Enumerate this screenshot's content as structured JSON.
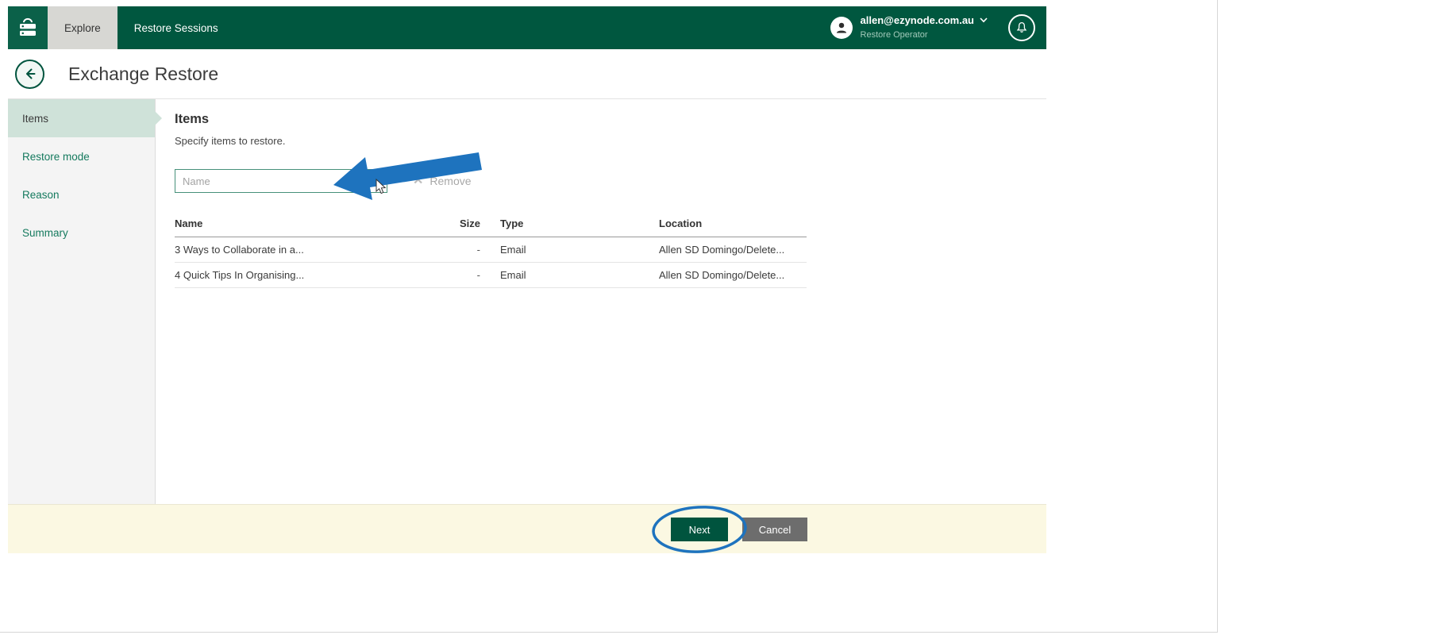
{
  "topbar": {
    "tabs": [
      {
        "label": "Explore",
        "active": true
      },
      {
        "label": "Restore Sessions",
        "active": false
      }
    ],
    "user": {
      "email": "allen@ezynode.com.au",
      "role": "Restore Operator"
    }
  },
  "header": {
    "title": "Exchange Restore"
  },
  "sidebar": {
    "steps": [
      {
        "label": "Items",
        "active": true
      },
      {
        "label": "Restore mode",
        "active": false
      },
      {
        "label": "Reason",
        "active": false
      },
      {
        "label": "Summary",
        "active": false
      }
    ]
  },
  "content": {
    "heading": "Items",
    "description": "Specify items to restore.",
    "filter": {
      "placeholder": "Name"
    },
    "remove_button": "Remove",
    "table": {
      "columns": {
        "name": "Name",
        "size": "Size",
        "type": "Type",
        "location": "Location"
      },
      "rows": [
        {
          "name": "3 Ways to Collaborate in a...",
          "size": "-",
          "type": "Email",
          "location": "Allen SD Domingo/Delete..."
        },
        {
          "name": "4 Quick Tips In Organising...",
          "size": "-",
          "type": "Email",
          "location": "Allen SD Domingo/Delete..."
        }
      ]
    }
  },
  "footer": {
    "next": "Next",
    "cancel": "Cancel"
  },
  "icons": {
    "logo": "server-stack",
    "avatar": "person",
    "chevron": "chevron-down",
    "bell": "bell",
    "back": "arrow-left",
    "remove_glyph": "✕"
  },
  "colors": {
    "brand_green": "#00573f",
    "button_green": "#00543e",
    "sidebar_active": "#cfe2d9",
    "footer_yellow": "#fbf8e2",
    "annotation_blue": "#1e73be"
  }
}
